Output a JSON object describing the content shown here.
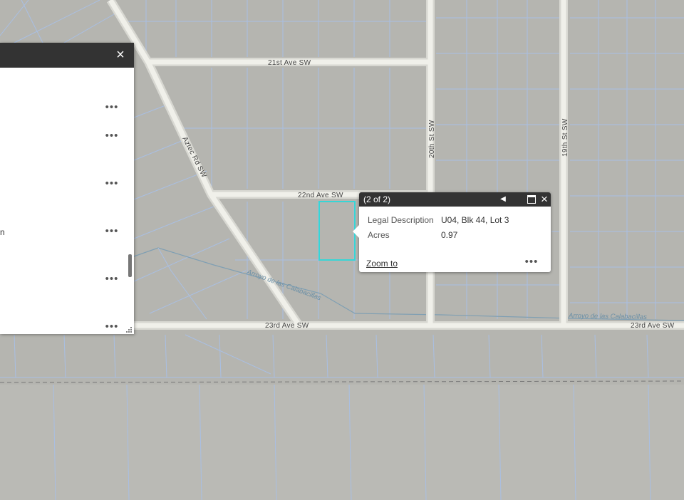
{
  "map": {
    "streets": {
      "ave21": "21st Ave SW",
      "ave22": "22nd Ave SW",
      "ave23_left": "23rd Ave SW",
      "ave23_right": "23rd Ave SW",
      "aztec": "Aztec Rd SW",
      "st20": "20th St SW",
      "st19": "19th St SW"
    },
    "arroyo_left": "Arroyo de las Calabacillas",
    "arroyo_right": "Arroyo de las Calabacillas",
    "selection_color": "#36d6d6",
    "background_color": "#b5b5b0",
    "parcel_line_color": "#a9bfe3"
  },
  "side_panel": {
    "close_icon": "×",
    "row_menu_icon": "•••",
    "fragment_text": "n",
    "row_count": 6
  },
  "popup": {
    "title": "(2 of 2)",
    "prev_icon": "◀",
    "close_icon": "×",
    "fields": [
      {
        "label": "Legal Description",
        "value": "U04, Blk 44, Lot 3"
      },
      {
        "label": "Acres",
        "value": "0.97"
      }
    ],
    "zoom_to": "Zoom to",
    "menu_icon": "•••"
  }
}
